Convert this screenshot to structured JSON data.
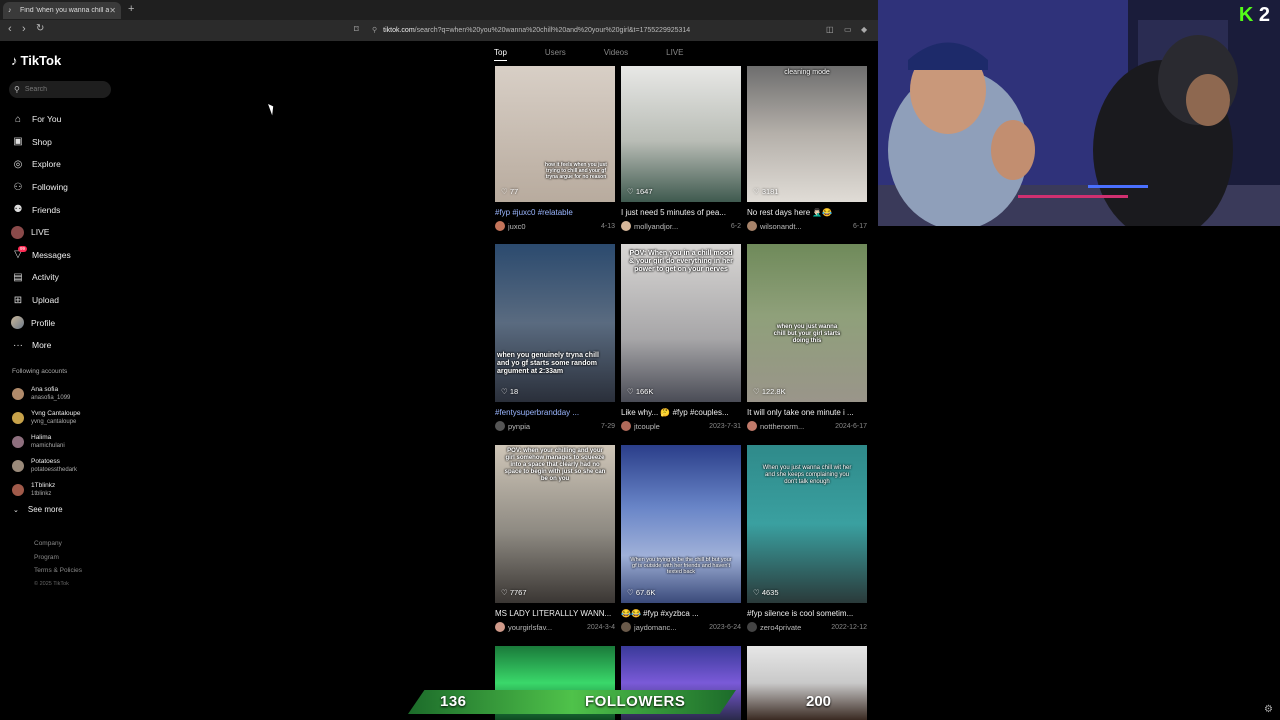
{
  "browser": {
    "tab_title": "Find 'when you wanna chill an...",
    "url_domain": "tiktok.com",
    "url_path": "/search?q=when%20you%20wanna%20chill%20and%20your%20girl&t=1755229925314"
  },
  "sidebar": {
    "logo": "TikTok",
    "search_placeholder": "Search",
    "nav": [
      {
        "label": "For You",
        "icon": "home-icon"
      },
      {
        "label": "Shop",
        "icon": "shop-icon"
      },
      {
        "label": "Explore",
        "icon": "explore-icon"
      },
      {
        "label": "Following",
        "icon": "following-icon"
      },
      {
        "label": "Friends",
        "icon": "friends-icon"
      },
      {
        "label": "LIVE",
        "icon": "live-icon"
      },
      {
        "label": "Messages",
        "icon": "messages-icon",
        "badge": "99"
      },
      {
        "label": "Activity",
        "icon": "activity-icon"
      },
      {
        "label": "Upload",
        "icon": "upload-icon"
      },
      {
        "label": "Profile",
        "icon": "profile-icon"
      },
      {
        "label": "More",
        "icon": "more-icon"
      }
    ],
    "following_title": "Following accounts",
    "following": [
      {
        "name": "Ana sofia",
        "handle": "anasofia_1099"
      },
      {
        "name": "Yvng Cantaloupe",
        "handle": "yvng_cantaloupe"
      },
      {
        "name": "Halima",
        "handle": "mamichulani"
      },
      {
        "name": "Potatoess",
        "handle": "potatoessthedark"
      },
      {
        "name": "1Tblinkz",
        "handle": "1tblinkz"
      }
    ],
    "see_more": "See more",
    "footer": [
      "Company",
      "Program",
      "Terms & Policies"
    ],
    "copyright": "© 2025 TikTok"
  },
  "tabs": [
    "Top",
    "Users",
    "Videos",
    "LIVE"
  ],
  "videos": [
    {
      "likes": "77",
      "desc": "#fyp #juxc0 #relatable",
      "user": "juxc0",
      "date": "4-13",
      "caption": "how it feels when you just trying to chill and your gf tryna argue for no reason",
      "tag": true
    },
    {
      "likes": "1647",
      "desc": "I just need 5 minutes of pea...",
      "user": "mollyandjor...",
      "date": "6-2",
      "caption": ""
    },
    {
      "likes": "3181",
      "desc": "No rest days here 🤦🏻‍♂️😂",
      "user": "wilsonandt...",
      "date": "6-17",
      "caption": "cleaning mode"
    },
    {
      "likes": "18",
      "desc": "#fentysuperbrandday ...",
      "user": "pynpia",
      "date": "7-29",
      "caption": "when you genuinely tryna chill and yo gf starts some random argument at 2:33am",
      "tag": true
    },
    {
      "likes": "166K",
      "desc": "Like why... 🤔 #fyp #couples...",
      "user": "jtcouple",
      "date": "2023-7-31",
      "caption": "POV: When you in a chill mood & your girl do everything in her power to get on your nerves"
    },
    {
      "likes": "122.8K",
      "desc": "It will only take one minute i ...",
      "user": "notthenorm...",
      "date": "2024-6-17",
      "caption": "when you just wanna chill but your girl starts doing this"
    },
    {
      "likes": "7767",
      "desc": "MS LADY LITERALLLY WANN...",
      "user": "yourgirlsfav...",
      "date": "2024-3-4",
      "caption": "POV: when your chilling and your girl somehow manages to squeeze into a space that clearly had no space to begin with just so she can be on you"
    },
    {
      "likes": "67.6K",
      "desc": "😂😂 #fyp #xyzbca ...",
      "user": "jaydomanc...",
      "date": "2023-6-24",
      "caption": "When you trying to be the chill bf but your gf is outside with her friends and haven't texted back"
    },
    {
      "likes": "4635",
      "desc": "#fyp silence is cool sometim...",
      "user": "zero4private",
      "date": "2022-12-12",
      "caption": "When you just wanna chill wit her and she keeps complaining you don't talk enough"
    },
    {
      "likes": "",
      "desc": "",
      "user": "",
      "date": "",
      "caption": ""
    },
    {
      "likes": "",
      "desc": "",
      "user": "",
      "date": "",
      "caption": ""
    },
    {
      "likes": "",
      "desc": "",
      "user": "",
      "date": "",
      "caption": ""
    }
  ],
  "overlay": {
    "followers_count": "136",
    "followers_label": "FOLLOWERS",
    "goal": "200",
    "cam_logo_k": "K",
    "cam_logo_num": "2"
  }
}
